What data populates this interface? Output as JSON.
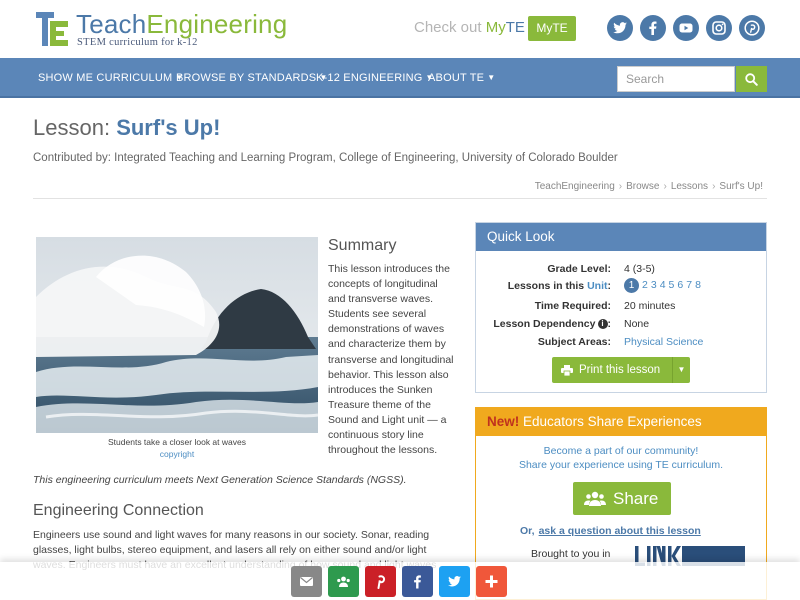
{
  "header": {
    "logo_teach": "Teach",
    "logo_engineering": "Engineering",
    "logo_tagline": "STEM curriculum for k-12",
    "checkout_text": "Check out",
    "checkout_my": "My",
    "checkout_te": "TE",
    "myte_button": "MyTE",
    "social": [
      "twitter-icon",
      "facebook-icon",
      "youtube-icon",
      "instagram-icon",
      "pinterest-icon"
    ]
  },
  "nav": {
    "items": [
      {
        "label": "SHOW ME CURRICULUM"
      },
      {
        "label": "BROWSE BY STANDARDS"
      },
      {
        "label": "K-12 ENGINEERING"
      },
      {
        "label": "ABOUT TE"
      }
    ],
    "search_placeholder": "Search"
  },
  "page": {
    "title_prefix": "Lesson:",
    "title": "Surf's Up!",
    "contributed": "Contributed by: Integrated Teaching and Learning Program, College of Engineering, University of Colorado Boulder",
    "breadcrumb": [
      "TeachEngineering",
      "Browse",
      "Lessons",
      "Surf's Up!"
    ]
  },
  "summary": {
    "image_caption": "Students take a closer look at waves",
    "image_copyright": "copyright",
    "heading": "Summary",
    "text": "This lesson introduces the concepts of longitudinal and transverse waves. Students see several demonstrations of waves and characterize them by transverse and longitudinal behavior. This lesson also introduces the Sunken Treasure theme of the Sound and Light unit — a continuous story line throughout the lessons.",
    "ngss": "This engineering curriculum meets Next Generation Science Standards (NGSS)."
  },
  "engineering": {
    "heading": "Engineering Connection",
    "text": "Engineers use sound and light waves for many reasons in our society. Sonar, reading glasses, light bulbs, stereo equipment, and lasers all rely on either sound and/or light waves. Engineers must have an excellent understanding of how sound and light waves"
  },
  "quick_look": {
    "heading": "Quick Look",
    "grade_label": "Grade Level:",
    "grade_value": "4 (3-5)",
    "lessons_label": "Lessons in this",
    "lessons_unit_link": "Unit",
    "lessons_colon": ":",
    "unit_current": "1",
    "unit_others": [
      "2",
      "3",
      "4",
      "5",
      "6",
      "7",
      "8"
    ],
    "time_label": "Time Required:",
    "time_value": "20 minutes",
    "dependency_label": "Lesson Dependency",
    "dependency_value": "None",
    "subject_label": "Subject Areas:",
    "subject_value": "Physical Science",
    "print_button": "Print this lesson"
  },
  "share": {
    "new_label": "New!",
    "heading": "Educators Share Experiences",
    "line1": "Become a part of our community!",
    "line2": "Share your experience using TE curriculum.",
    "share_button": "Share",
    "or_text": "Or,",
    "ask_link": "ask a question about this lesson",
    "brought_to_you": "Brought to you in",
    "partner_logo_text": "LINKENGINEERING"
  },
  "bottom_share": [
    {
      "icon": "email-icon",
      "color": "#888888"
    },
    {
      "icon": "classroom-icon",
      "color": "#2e9a4e"
    },
    {
      "icon": "pinterest-icon",
      "color": "#cb2027"
    },
    {
      "icon": "facebook-icon",
      "color": "#3b5998"
    },
    {
      "icon": "twitter-icon",
      "color": "#1da1f2"
    },
    {
      "icon": "more-icon",
      "color": "#f0573a"
    }
  ],
  "colors": {
    "brand_blue": "#4c79a8",
    "nav_blue": "#5b86b8",
    "brand_green": "#8ab93b",
    "share_orange": "#f0a91e",
    "link": "#4c8dc2"
  }
}
